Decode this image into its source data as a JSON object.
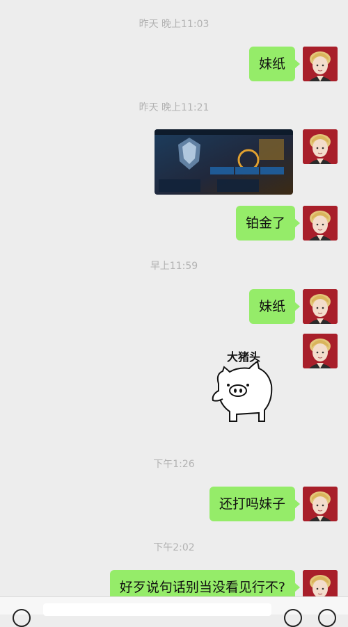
{
  "chat": {
    "timestamps": [
      "昨天 晚上11:03",
      "昨天 晚上11:21",
      "早上11:59",
      "下午1:26",
      "下午2:02"
    ],
    "messages": [
      "妹纸",
      "铂金了",
      "妹纸",
      "还打吗妹子",
      "好歹说句话别当没看见行不?"
    ],
    "sticker_caption": "大猪头"
  },
  "colors": {
    "bubble": "#95ec69",
    "background": "#ededed",
    "avatar_bg": "#a81f2a"
  },
  "icons": [
    "voice-icon",
    "emoji-icon",
    "plus-icon"
  ]
}
